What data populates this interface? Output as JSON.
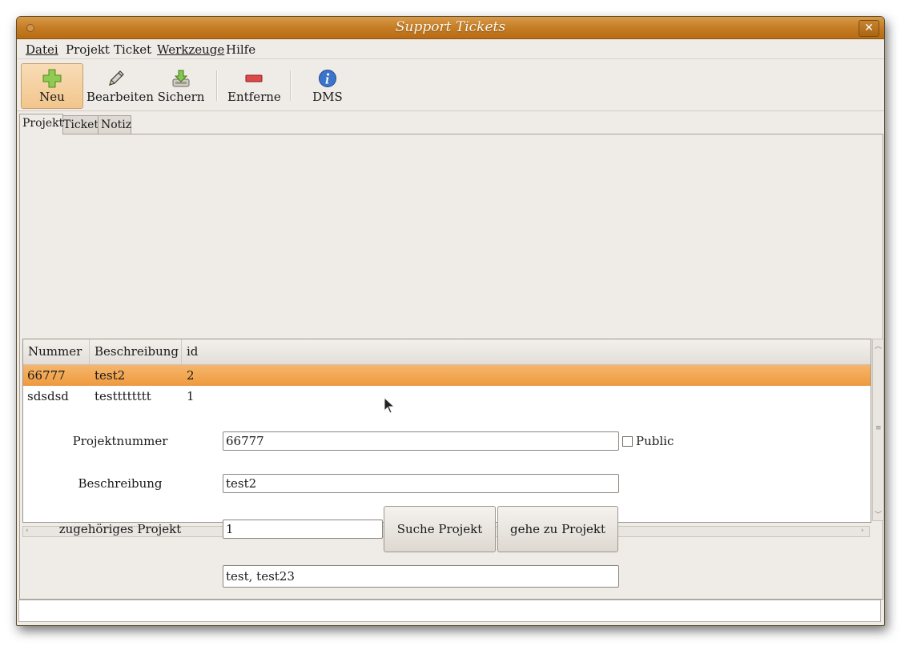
{
  "window": {
    "title": "Support Tickets",
    "close_glyph": "✕"
  },
  "menu": [
    {
      "label": "Datei"
    },
    {
      "label": "Projekt"
    },
    {
      "label": "Ticket"
    },
    {
      "label": "Werkzeuge"
    },
    {
      "label": "Hilfe"
    }
  ],
  "toolbar": {
    "new_label": "Neu",
    "edit_label": "Bearbeiten",
    "save_label": "Sichern",
    "remove_label": "Entferne",
    "dms_label": "DMS"
  },
  "icons": {
    "new": "plus-icon",
    "edit": "pencil-icon",
    "save": "save-icon",
    "remove": "minus-icon",
    "dms": "info-icon"
  },
  "colors": {
    "titlebar": "#c47b22",
    "selection": "#f2a552",
    "new_icon": "#7bc142",
    "remove_icon": "#d33b3b",
    "info_icon": "#3b74c9"
  },
  "tabs": [
    {
      "label": "Projekt",
      "selected": true
    },
    {
      "label": "Ticket",
      "selected": false
    },
    {
      "label": "Notiz",
      "selected": false
    }
  ],
  "table": {
    "columns": [
      "Nummer",
      "Beschreibung",
      "id"
    ],
    "rows": [
      {
        "nummer": "66777",
        "beschreibung": "test2",
        "id": "2",
        "selected": true
      },
      {
        "nummer": "sdsdsd",
        "beschreibung": "testttttttt",
        "id": "1",
        "selected": false
      }
    ]
  },
  "form": {
    "projektnummer_label": "Projektnummer",
    "projektnummer_value": "66777",
    "public_label": "Public",
    "public_checked": false,
    "beschreibung_label": "Beschreibung",
    "beschreibung_value": "test2",
    "zugehoeriges_label": "zugehöriges Projekt",
    "zugehoeriges_value": "1",
    "suche_button": "Suche Projekt",
    "gehe_button": "gehe zu Projekt",
    "related_value": "test, test23"
  }
}
